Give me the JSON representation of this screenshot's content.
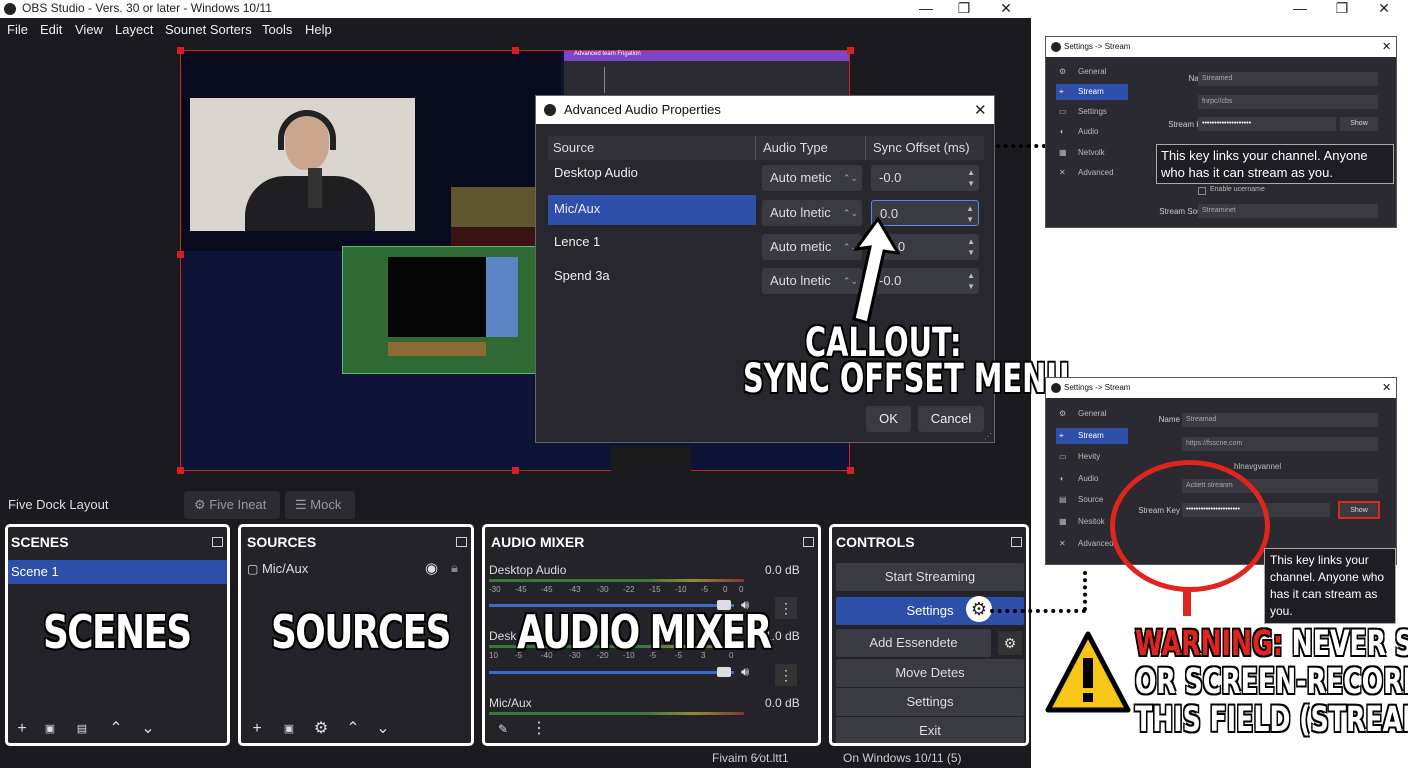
{
  "window": {
    "title": "OBS Studio - Vers. 30 or later - Windows 10/11",
    "min": "—",
    "max": "❐",
    "close": "✕"
  },
  "menu": [
    "File",
    "Edit",
    "View",
    "Layect",
    "Sounet Sorters",
    "Tools",
    "Help"
  ],
  "preview": {
    "title_bar_text": "Advanced team Frigation"
  },
  "dialog": {
    "title": "Advanced Audio Properties",
    "close": "✕",
    "columns": [
      "Source",
      "Audio Type",
      "Sync Offset (ms)"
    ],
    "rows": [
      {
        "source": "Desktop Audio",
        "type": "Auto metic",
        "offset": "-0.0",
        "selected": false
      },
      {
        "source": "Mic/Aux",
        "type": "Auto lnetic",
        "offset": "0.0",
        "selected": true
      },
      {
        "source": "Lence 1",
        "type": "Auto metic",
        "offset": "0.0",
        "selected": false
      },
      {
        "source": "Spend 3a",
        "type": "Auto lnetic",
        "offset": "-0.0",
        "selected": false
      }
    ],
    "ok": "OK",
    "cancel": "Cancel"
  },
  "callout_main": {
    "line1": "CALLOUT:",
    "line2": "SYNC OFFSET MENU"
  },
  "dock_bar": {
    "layout_label": "Five Dock Layout",
    "btn1": "Five Ineat",
    "btn2": "Mock"
  },
  "scenes": {
    "header": "SCENES",
    "items": [
      "Scene 1"
    ],
    "overlay": "SCENES"
  },
  "sources": {
    "header": "SOURCES",
    "items": [
      "Mic/Aux"
    ],
    "overlay": "SOURCES"
  },
  "mixer": {
    "header": "AUDIO MIXER",
    "overlay": "AUDIO MIXER",
    "channels": [
      {
        "name": "Desktop Audio",
        "db": "0.0 dB"
      },
      {
        "name": "Desk",
        "db": "1.0 dB"
      },
      {
        "name": "Mic/Aux",
        "db": "0.0 dB"
      }
    ],
    "ticks": [
      "-30",
      "-45",
      "-45",
      "-43",
      "-30",
      "-22",
      "-15",
      "-10",
      "-5",
      "0",
      "0"
    ],
    "ticks2": [
      "10",
      "-5",
      "-40",
      "-30",
      "-20",
      "-10",
      "-5",
      "-5",
      "3",
      "0"
    ]
  },
  "controls": {
    "header": "CONTROLS",
    "buttons": [
      "Start Streaming",
      "Settings",
      "Add Essendete",
      "Move Detes",
      "Settings",
      "Exit"
    ]
  },
  "status_bar": {
    "left": "Fivaim 6⁄ot.ltt1",
    "right": "On  Windows 10/11 (5)"
  },
  "settings_top": {
    "title": "Settings -> Stream",
    "nav": [
      "General",
      "Stream",
      "Settings",
      "Audio",
      "Netvolk",
      "Advanced"
    ],
    "name_label": "Name",
    "name_value": "Streamed",
    "url_value": "fnrpc//cbs",
    "key_label": "Stream Key",
    "key_value": "••••••••••••••••••••",
    "show": "Show",
    "enable_username": "Enable ucername",
    "source_label": "Stream Souce",
    "source_value": "Streaminet",
    "tooltip": "This key links your channel. Anyone who has it can stream as you."
  },
  "settings_bottom": {
    "title": "Settings -> Stream",
    "nav": [
      "General",
      "Stream",
      "Hevity",
      "Audio",
      "Source",
      "Nesitok",
      "Advanced"
    ],
    "name_label": "Name",
    "name_value": "Streamad",
    "url_value": "https://fsscne.com",
    "channel_text": "hlnavgvannel",
    "auth_value": "Actiett streanm",
    "key_label": "Stream Key",
    "key_value": "••••••••••••••••••••••",
    "show": "Show",
    "tooltip": "This key links your channel. Anyone who has it can stream as you."
  },
  "warning": {
    "word": "WARNING:",
    "line1_rest": " NEVER SHARE",
    "line2": "OR SCREEN-RECORD",
    "line3": "THIS FIELD (STREAM KEY)"
  },
  "outer_window": {
    "min": "—",
    "max": "❐",
    "close": "✕"
  },
  "colors": {
    "accent": "#2d4faa",
    "bg": "#232329",
    "warning_red": "#e0241e",
    "warning_yellow": "#f5c518"
  }
}
